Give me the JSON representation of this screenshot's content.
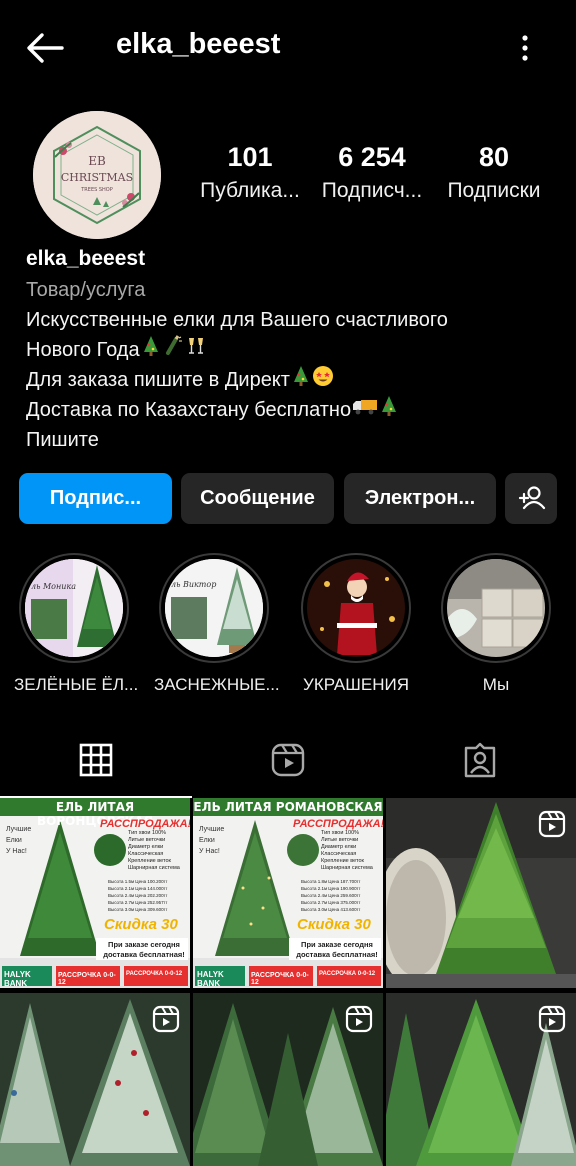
{
  "header": {
    "username": "elka_beeest"
  },
  "profile": {
    "avatar_text_1": "EB",
    "avatar_text_2": "CHRISTMAS",
    "avatar_text_3": "TREES SHOP",
    "stats": [
      {
        "value": "101",
        "label": "Публика..."
      },
      {
        "value": "6 254",
        "label": "Подписч..."
      },
      {
        "value": "80",
        "label": "Подписки"
      }
    ],
    "name": "elka_beeest",
    "category": "Товар/услуга",
    "bio_lines": [
      "Искусственные елки для Вашего счастливого",
      "Нового Года",
      "Для заказа пишите в Директ",
      "Доставка по Казахстану бесплатно",
      "Пишите"
    ]
  },
  "actions": {
    "follow": "Подпис...",
    "message": "Сообщение",
    "email": "Электрон..."
  },
  "highlights": [
    {
      "label": "ЗЕЛЁНЫЕ ЁЛ...",
      "thumb_text": "ль Моника"
    },
    {
      "label": "ЗАСНЕЖНЫЕ...",
      "thumb_text": "ль Виктор"
    },
    {
      "label": "УКРАШЕНИЯ"
    },
    {
      "label": "Мы"
    }
  ],
  "posts": [
    {
      "banner": "ЕЛЬ ЛИТАЯ ВОРОНЦОВСКАЯ",
      "sale": "РАССПРОДАЖА!",
      "left_note": [
        "Лучшие",
        "Елки",
        "У Нас!"
      ],
      "features": [
        "Тип хвои 100%",
        "Литые веточки",
        "Диаметр елки",
        "Классическая",
        "Крепление веток",
        "Шарнирная система"
      ],
      "prices": [
        "Высота 1.5м Цена 100.200тг",
        "Высота 2.1м Цена 144.000тг",
        "Высота 2.4м Цена 202.200тг",
        "Высота 2.7м Цена 252.957тг",
        "Высота 3.0м Цена 309.600тг"
      ],
      "discount": "Скидка 30",
      "delivery": [
        "При заказе сегодня",
        "доставка бесплатная!"
      ],
      "bank": "HALYK BANK",
      "installment": "РАССРОЧКА 0-0-12",
      "kaspi": "РАССРОЧКА 0-0-12"
    },
    {
      "banner": "ЕЛЬ ЛИТАЯ РОМАНОВСКАЯ",
      "sale": "РАССПРОДАЖА!",
      "left_note": [
        "Лучшие",
        "Елки",
        "У Нас!"
      ],
      "features": [
        "Тип хвои 100%",
        "Литые веточки",
        "Диаметр елки",
        "Классическая",
        "Крепление веток",
        "Шарнирная система"
      ],
      "prices": [
        "Высота 1.8м Цена 187.700тг",
        "Высота 2.1м Цена 190.900тг",
        "Высота 2.4м Цена 259.600тг",
        "Высота 2.7м Цена 375.000тг",
        "Высота 3.0м Цена 413.600тг"
      ],
      "discount": "Скидка 30",
      "delivery": [
        "При заказе сегодня",
        "доставка бесплатная!"
      ],
      "bank": "HALYK BANK",
      "installment": "РАССРОЧКА 0-0-12",
      "kaspi": "РАССРОЧКА 0-0-12"
    }
  ],
  "colors": {
    "primary": "#0095f6",
    "secondary_btn": "#262626",
    "background": "#000000"
  }
}
